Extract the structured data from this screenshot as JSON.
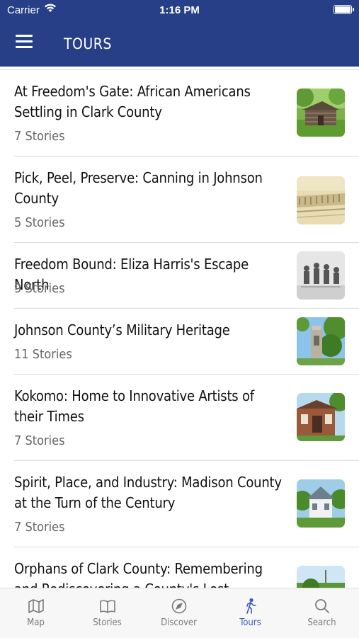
{
  "status_bar": {
    "carrier": "Carrier",
    "time": "1:16 PM"
  },
  "header": {
    "title": "TOURS",
    "color": "#263f87"
  },
  "tours": [
    {
      "title": "At Freedom's Gate: African Americans Settling in Clark County",
      "stories": "7 Stories"
    },
    {
      "title": "Pick, Peel, Preserve: Canning in Johnson County",
      "stories": "5 Stories"
    },
    {
      "title": "Freedom Bound: Eliza Harris's Escape North",
      "stories": "9 Stories"
    },
    {
      "title": "Johnson County’s Military Heritage",
      "stories": "11 Stories"
    },
    {
      "title": "Kokomo: Home to Innovative Artists of their Times",
      "stories": "7 Stories"
    },
    {
      "title": "Spirit, Place, and Industry: Madison County at the Turn of the Century",
      "stories": "7 Stories"
    },
    {
      "title": "Orphans of Clark County: Remembering and Rediscovering a County's Lost Children",
      "stories": ""
    }
  ],
  "tabbar": {
    "active": "Tours",
    "active_color": "#3b5bb5",
    "tabs": [
      {
        "label": "Map",
        "icon": "map-icon"
      },
      {
        "label": "Stories",
        "icon": "book-icon"
      },
      {
        "label": "Discover",
        "icon": "compass-icon"
      },
      {
        "label": "Tours",
        "icon": "walking-icon"
      },
      {
        "label": "Search",
        "icon": "search-icon"
      }
    ]
  }
}
